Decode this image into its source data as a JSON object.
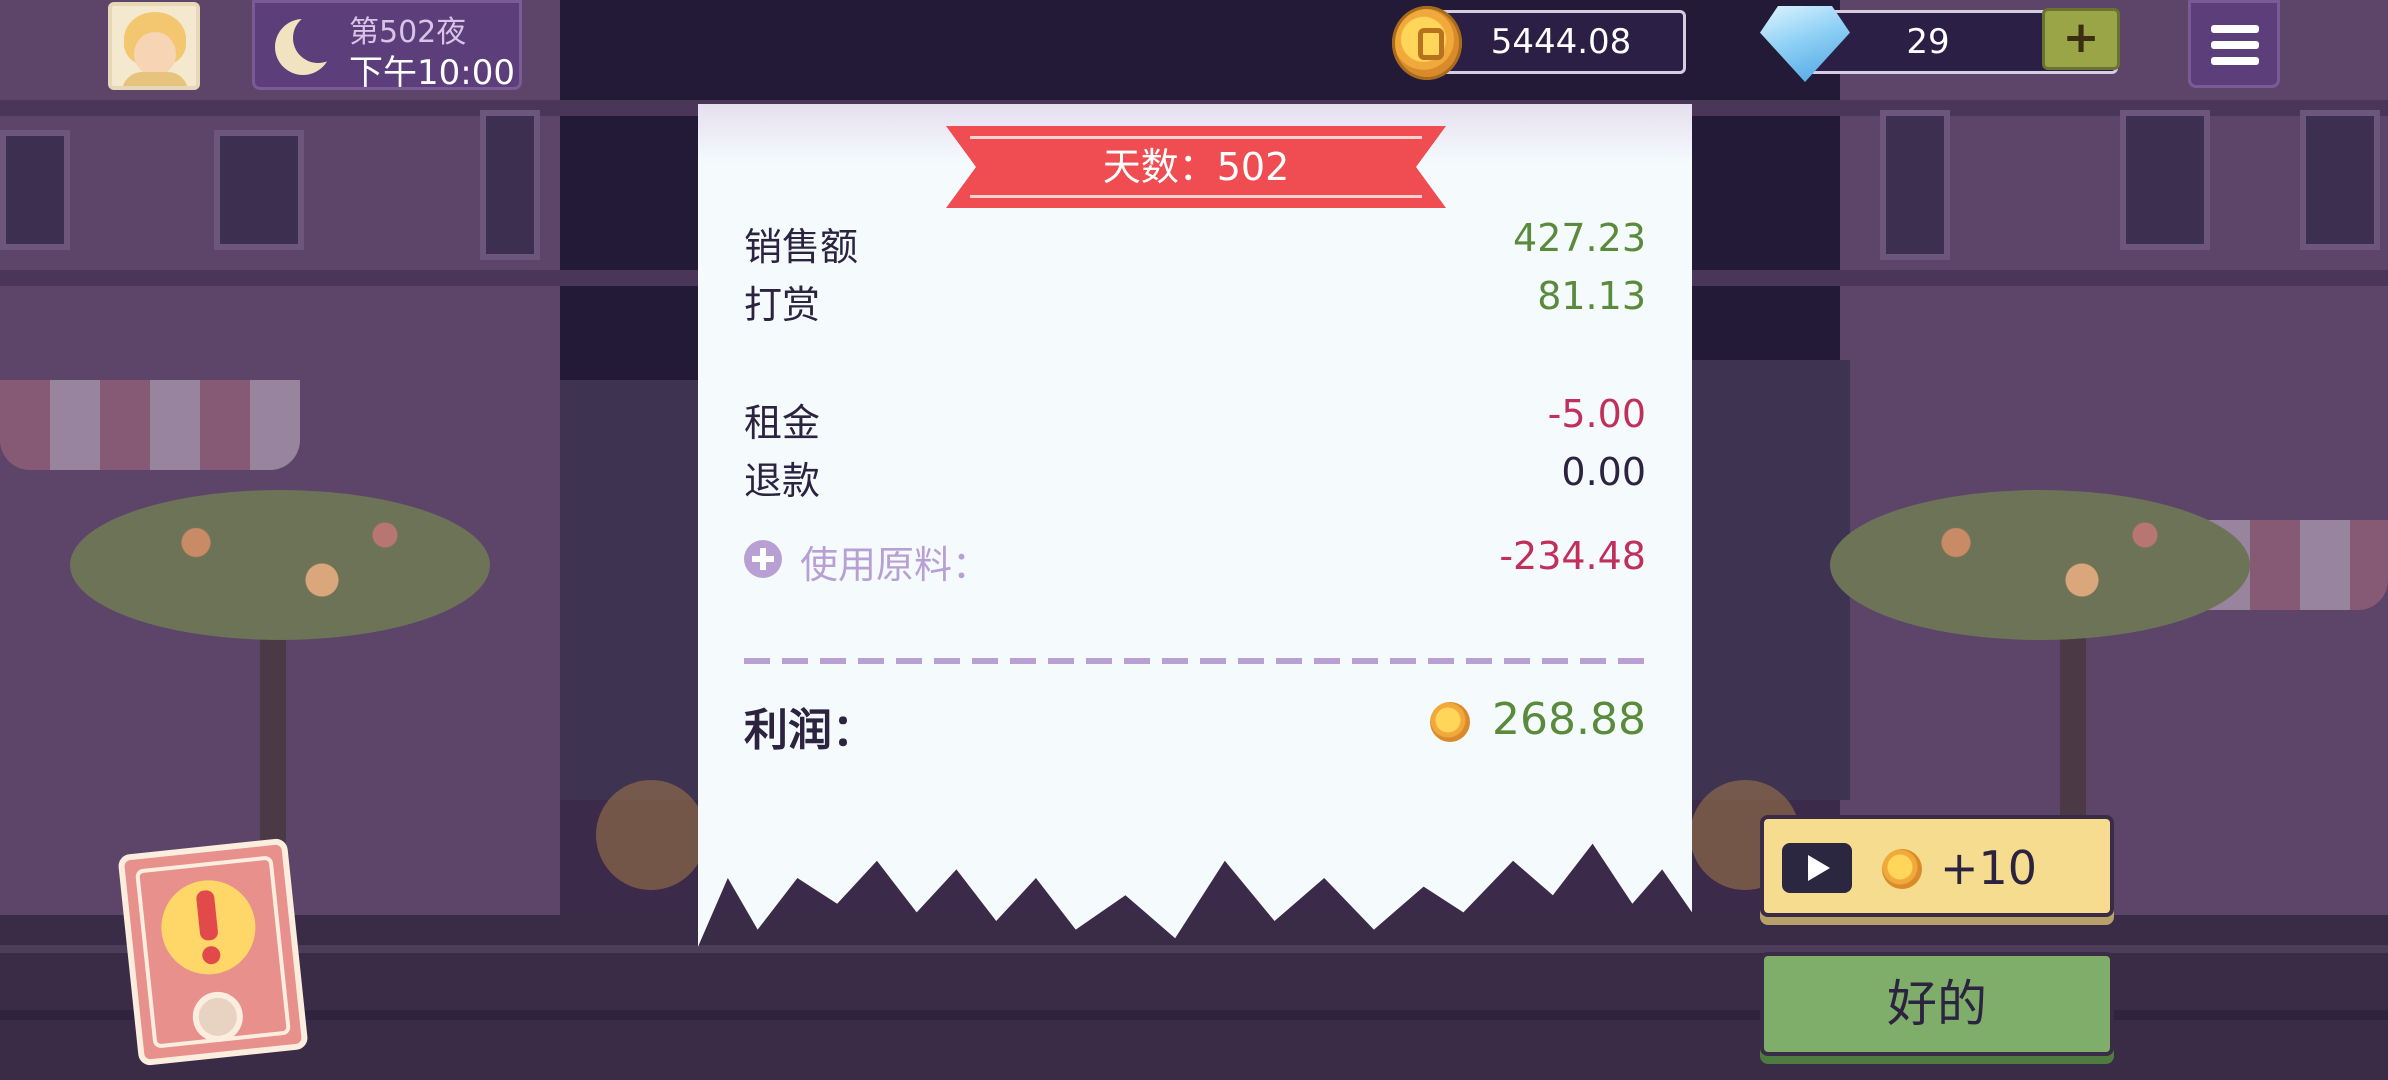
{
  "hud": {
    "night_label": "第502夜",
    "time": "下午10:00",
    "coins": "5444.08",
    "gems": "29",
    "plus_label": "+"
  },
  "receipt": {
    "day_banner": "天数：502",
    "rows": [
      {
        "label": "销售额",
        "value": "427.23"
      },
      {
        "label": "打赏",
        "value": "81.13"
      },
      {
        "label": "租金",
        "value": "-5.00"
      },
      {
        "label": "退款",
        "value": "0.00"
      }
    ],
    "ingredients_label": "使用原料：",
    "ingredients_value": "-234.48",
    "profit_label": "利润：",
    "profit_value": "268.88"
  },
  "buttons": {
    "ad_reward": "+10",
    "ok": "好的"
  },
  "icons": [
    "avatar",
    "moon-icon",
    "coin-icon",
    "gem-icon",
    "menu-icon",
    "plus-circle-icon",
    "play-icon",
    "alert-icon"
  ],
  "colors": {
    "positive": "#5a8a3c",
    "negative": "#c0305a",
    "ribbon": "#ef4d52",
    "ok_button": "#7fae6a",
    "ad_button": "#f6dc8e"
  }
}
